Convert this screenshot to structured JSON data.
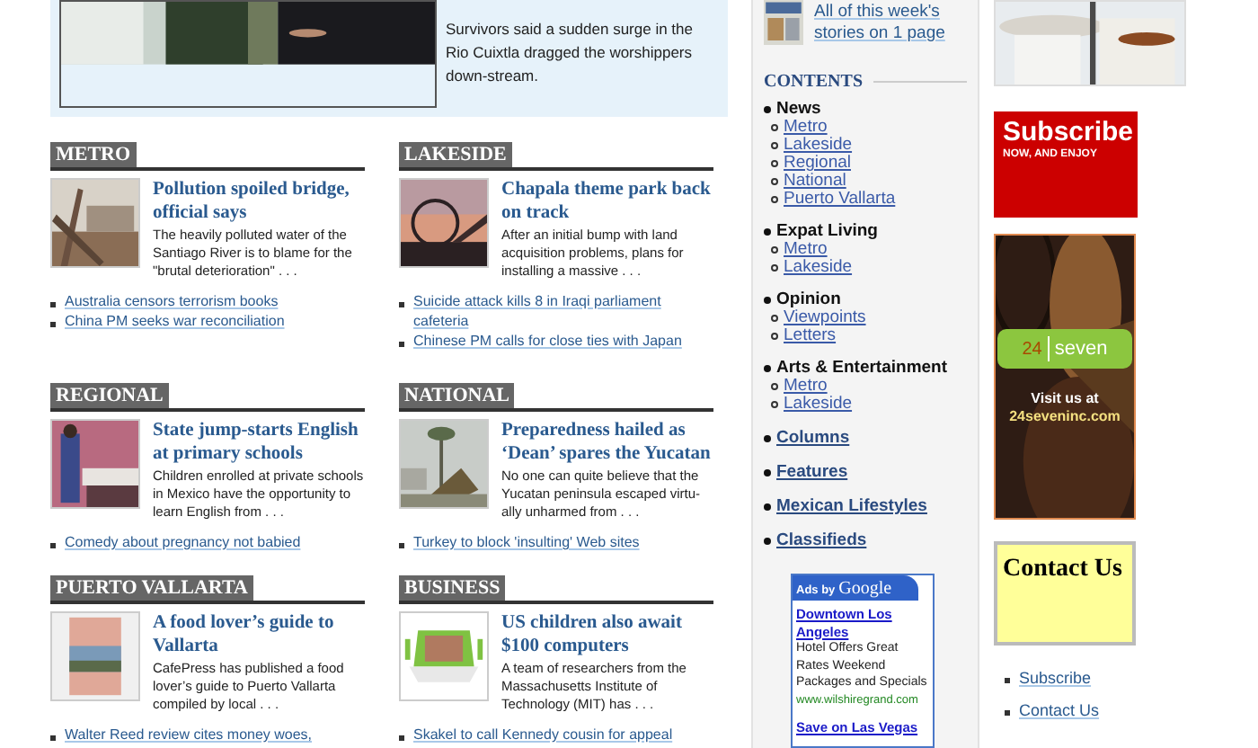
{
  "feature": {
    "summary": "Survivors said a sudden surge in the Rio Cuixtla dragged the worshippers down-stream."
  },
  "sections": [
    {
      "title": "METRO",
      "story": {
        "headline": "Pollution spoiled bridge, official says",
        "summary": "The heavily polluted water of the Santiago River is to blame for the \"brutal deterioration\"  . . ."
      },
      "links": [
        "Australia censors terrorism books",
        "China PM seeks war reconciliation"
      ]
    },
    {
      "title": "LAKESIDE",
      "story": {
        "headline": "Chapala theme park back on track",
        "summary": "After an initial bump with land acquisition problems, plans for installing a massive . . ."
      },
      "links": [
        "Suicide attack kills 8 in Iraqi parliament cafeteria",
        "Chinese PM calls for close ties with Japan"
      ]
    },
    {
      "title": "REGIONAL",
      "story": {
        "headline": "State jump-starts English at primary schools",
        "summary": "Children enrolled at private schools in Mexico have the opportunity to learn English from . . ."
      },
      "links": [
        "Comedy about pregnancy not babied"
      ]
    },
    {
      "title": "NATIONAL",
      "story": {
        "headline": "Preparedness hailed as ‘Dean’ spares the Yucatan",
        "summary": "No one can quite believe that the Yucatan peninsula escaped virtu-ally unharmed from  . . ."
      },
      "links": [
        "Turkey to block 'insulting' Web sites"
      ]
    },
    {
      "title": "PUERTO VALLARTA",
      "story": {
        "headline": "A food lover’s guide to Vallarta",
        "summary": "CafePress has published a food lover’s guide to Puerto Vallarta compiled by local  . . ."
      },
      "links": [
        "Walter Reed review cites money woes,"
      ]
    },
    {
      "title": "BUSINESS",
      "story": {
        "headline": "US children also await $100 computers",
        "summary": "A team of researchers from the Massachusetts Institute of Technology (MIT) has  . . ."
      },
      "links": [
        "Skakel to call Kennedy cousin for appeal"
      ]
    }
  ],
  "sidebar": {
    "weekly": "All of this week's stories on 1 page",
    "contents_title": "CONTENTS",
    "groups": [
      {
        "label": "News",
        "kind": "heading",
        "children": [
          "Metro",
          "Lakeside",
          "Regional",
          "National",
          "Puerto Vallarta"
        ]
      },
      {
        "label": "Expat Living",
        "kind": "heading",
        "children": [
          "Metro",
          "Lakeside"
        ]
      },
      {
        "label": "Opinion",
        "kind": "heading",
        "children": [
          "Viewpoints",
          "Letters"
        ]
      },
      {
        "label": "Arts & Entertainment",
        "kind": "heading",
        "children": [
          "Metro",
          "Lakeside"
        ]
      },
      {
        "label": "Columns",
        "kind": "link"
      },
      {
        "label": "Features",
        "kind": "link"
      },
      {
        "label": "Mexican Lifestyles",
        "kind": "link"
      },
      {
        "label": "Classifieds",
        "kind": "link"
      }
    ],
    "ads": {
      "prefix": "Ads by",
      "brand": "Google",
      "entries": [
        {
          "title": "Downtown Los Angeles",
          "body": "Hotel Offers Great Rates Weekend Packages and Specials",
          "url": "www.wilshiregrand.com"
        },
        {
          "title": "Save on Las Vegas"
        }
      ]
    }
  },
  "right": {
    "subscribe": {
      "title": "Subscribe",
      "subtitle": "NOW, AND ENJOY"
    },
    "seven": {
      "number": "24",
      "word": "seven",
      "tagline": "Visit us at",
      "site": "24seveninc.com"
    },
    "contact": {
      "title": "Contact Us"
    },
    "links": [
      "Subscribe",
      "Contact Us"
    ]
  }
}
